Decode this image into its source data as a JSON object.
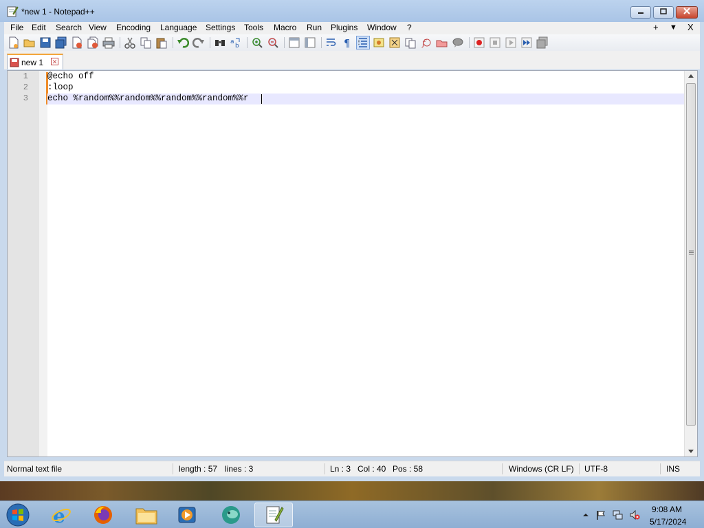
{
  "window": {
    "title": "*new 1 - Notepad++",
    "controls": [
      "minimize",
      "maximize",
      "close"
    ]
  },
  "menu": {
    "items": [
      "File",
      "Edit",
      "Search",
      "View",
      "Encoding",
      "Language",
      "Settings",
      "Tools",
      "Macro",
      "Run",
      "Plugins",
      "Window",
      "?"
    ],
    "right": [
      "+",
      "▼",
      "X"
    ]
  },
  "toolbar": {
    "icons": [
      "new-file-icon",
      "open-file-icon",
      "save-icon",
      "save-all-icon",
      "close-icon",
      "close-all-icon",
      "print-icon",
      "cut-icon",
      "copy-icon",
      "paste-icon",
      "undo-icon",
      "redo-icon",
      "find-icon",
      "replace-icon",
      "zoom-in-icon",
      "zoom-out-icon",
      "sync-vertical-icon",
      "sync-horizontal-icon",
      "word-wrap-icon",
      "show-all-characters-icon",
      "indent-guide-icon",
      "user-language-icon",
      "document-map-icon",
      "function-list-icon",
      "folder-workspace-icon",
      "monitoring-icon",
      "record-macro-icon",
      "stop-recording-icon",
      "playback-macro-icon",
      "run-macro-multiple-icon",
      "save-macro-icon"
    ]
  },
  "tab": {
    "label": "new 1",
    "close_glyph": "✕"
  },
  "editor": {
    "line_numbers": [
      "1",
      "2",
      "3"
    ],
    "lines": [
      "@echo off",
      ":loop",
      "echo %random%%random%%random%%random%%r"
    ]
  },
  "status": {
    "file_type": "Normal text file",
    "length": "length : 57",
    "lines": "lines : 3",
    "ln": "Ln : 3",
    "col": "Col : 40",
    "pos": "Pos : 58",
    "eol": "Windows (CR LF)",
    "encoding": "UTF-8",
    "mode": "INS"
  },
  "taskbar": {
    "apps": [
      "start-orb-icon",
      "internet-explorer-icon",
      "firefox-icon",
      "file-explorer-icon",
      "media-player-icon",
      "app-icon",
      "notepadpp-icon"
    ],
    "tray": [
      "show-hidden-icons-icon",
      "action-center-flag-icon",
      "network-icon",
      "volume-muted-icon"
    ],
    "time": "9:08 AM",
    "date": "5/17/2024"
  },
  "colors": {
    "accent_tab": "#f4a63a",
    "current_line": "#e8e8ff",
    "close_button": "#c7452e"
  }
}
